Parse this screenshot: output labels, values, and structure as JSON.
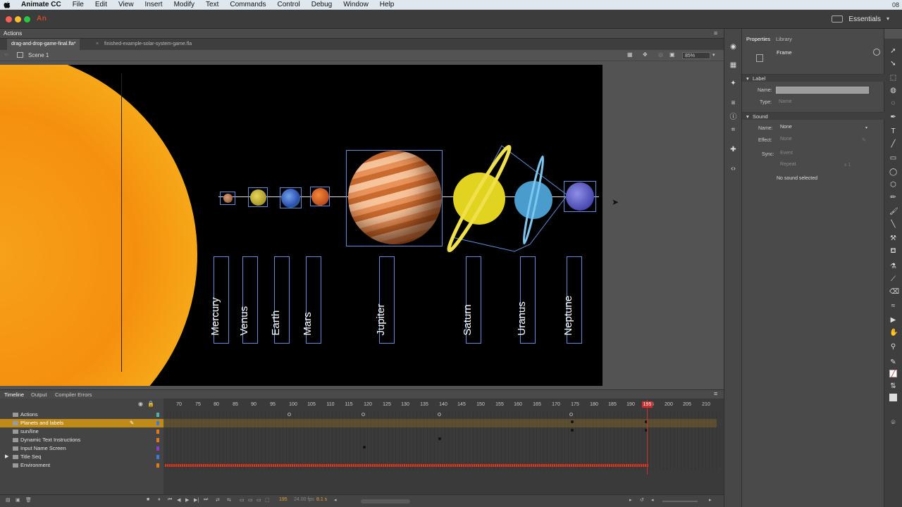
{
  "menubar": {
    "app_name": "Animate CC",
    "items": [
      "File",
      "Edit",
      "View",
      "Insert",
      "Modify",
      "Text",
      "Commands",
      "Control",
      "Debug",
      "Window",
      "Help"
    ],
    "right_text": "08"
  },
  "appbar": {
    "logo": "An",
    "workspace": "Essentials"
  },
  "actions_panel": {
    "title": "Actions"
  },
  "doc_tabs": [
    {
      "label": "drag-and-drop-game-final.fla*",
      "active": true
    },
    {
      "label": "finished-example-solar-system-game.fla",
      "active": false
    }
  ],
  "scene": {
    "label": "Scene 1",
    "zoom": "85%"
  },
  "stage": {
    "planet_labels": [
      "Mercury",
      "Venus",
      "Earth",
      "Mars",
      "Jupiter",
      "Saturn",
      "Uranus",
      "Neptune"
    ]
  },
  "properties": {
    "tabs": [
      "Properties",
      "Library"
    ],
    "object_type": "Frame",
    "label_section": "Label",
    "name_label": "Name:",
    "type_label": "Type:",
    "type_value": "Name",
    "sound_section": "Sound",
    "sound_name_label": "Name:",
    "sound_name_value": "None",
    "effect_label": "Effect:",
    "effect_value": "None",
    "sync_label": "Sync:",
    "sync_value": "Event",
    "repeat_value": "Repeat",
    "repeat_count": "x 1",
    "status": "No sound selected"
  },
  "timeline": {
    "tabs": [
      "Timeline",
      "Output",
      "Compiler Errors"
    ],
    "layers": [
      {
        "name": "Actions",
        "selected": false,
        "color": "#4fb3a8"
      },
      {
        "name": "Planets and labels",
        "selected": true,
        "color": "#3a7bd5"
      },
      {
        "name": "sun/line",
        "selected": false,
        "color": "#e07a1a"
      },
      {
        "name": "Dynamic Text Instructions",
        "selected": false,
        "color": "#e07a1a"
      },
      {
        "name": "Input Name Screen",
        "selected": false,
        "color": "#8a3ad0"
      },
      {
        "name": "Title Seq",
        "selected": false,
        "color": "#3a7bd5"
      },
      {
        "name": "Environment",
        "selected": false,
        "color": "#e07a1a"
      }
    ],
    "ruler": [
      "70",
      "75",
      "80",
      "85",
      "90",
      "95",
      "100",
      "105",
      "110",
      "115",
      "120",
      "125",
      "130",
      "135",
      "140",
      "145",
      "150",
      "155",
      "160",
      "165",
      "170",
      "175",
      "180",
      "185",
      "190",
      "195",
      "200",
      "205",
      "210"
    ],
    "current_frame": "195",
    "footer_frame": "195",
    "fps": "24.00 fps",
    "time": "8.1 s"
  }
}
